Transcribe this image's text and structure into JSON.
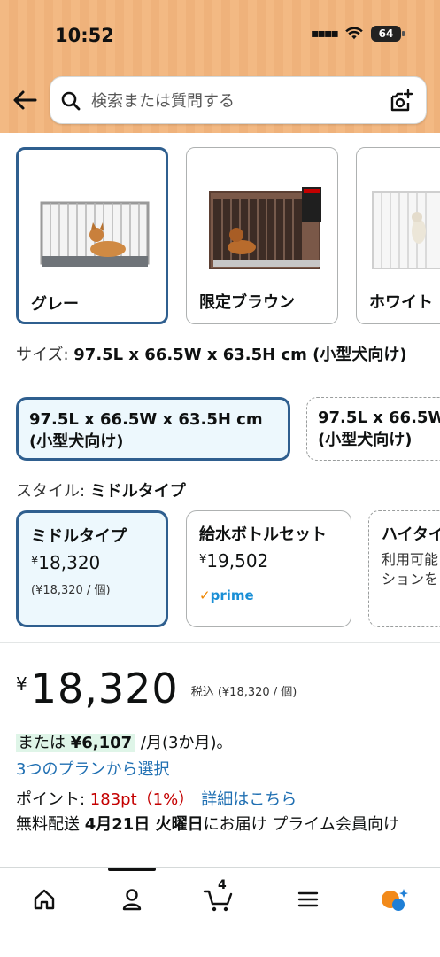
{
  "status_bar": {
    "time": "10:52",
    "battery": "64"
  },
  "search": {
    "placeholder": "検索または質問する"
  },
  "color_options": [
    {
      "label": "グレー",
      "selected": true
    },
    {
      "label": "限定ブラウン",
      "selected": false
    },
    {
      "label": "ホワイト",
      "selected": false
    }
  ],
  "size": {
    "label": "サイズ:",
    "value": "97.5L x 66.5W x 63.5H cm (小型犬向け)",
    "options": [
      {
        "line1": "97.5L x 66.5W x 63.5H cm",
        "line2": "(小型犬向け)",
        "selected": true
      },
      {
        "line1": "97.5L x 66.5W",
        "line2": "(小型犬向け)",
        "selected": false
      }
    ]
  },
  "style": {
    "label": "スタイル:",
    "value": "ミドルタイプ",
    "options": [
      {
        "name": "ミドルタイプ",
        "yen": "¥",
        "price": "18,320",
        "unit": "(¥18,320 / 個)",
        "selected": true
      },
      {
        "name": "給水ボトルセット",
        "yen": "¥",
        "price": "19,502",
        "badge": "prime",
        "selected": false
      },
      {
        "name": "ハイタイ",
        "desc1": "利用可能",
        "desc2": "ションを",
        "selected": false
      }
    ]
  },
  "price": {
    "yen": "¥",
    "amount": "18,320",
    "tax_note": "税込 (¥18,320 / 個)"
  },
  "installment": {
    "prefix": "または ",
    "amount": "¥6,107",
    "suffix": " /月(3か月)。",
    "plans_link": "3つのプランから選択"
  },
  "points": {
    "label": "ポイント: ",
    "value": "183pt（1%）",
    "link": "詳細はこちら"
  },
  "delivery": {
    "prefix": "無料配送 ",
    "date": "4月21日 火曜日",
    "suffix": "にお届け プライム会員向け"
  },
  "nav": {
    "cart_count": "4"
  },
  "colors": {
    "accent_border": "#2f5f8f",
    "link": "#1f6fb2",
    "points_red": "#c40000",
    "header": "#f3b983"
  }
}
